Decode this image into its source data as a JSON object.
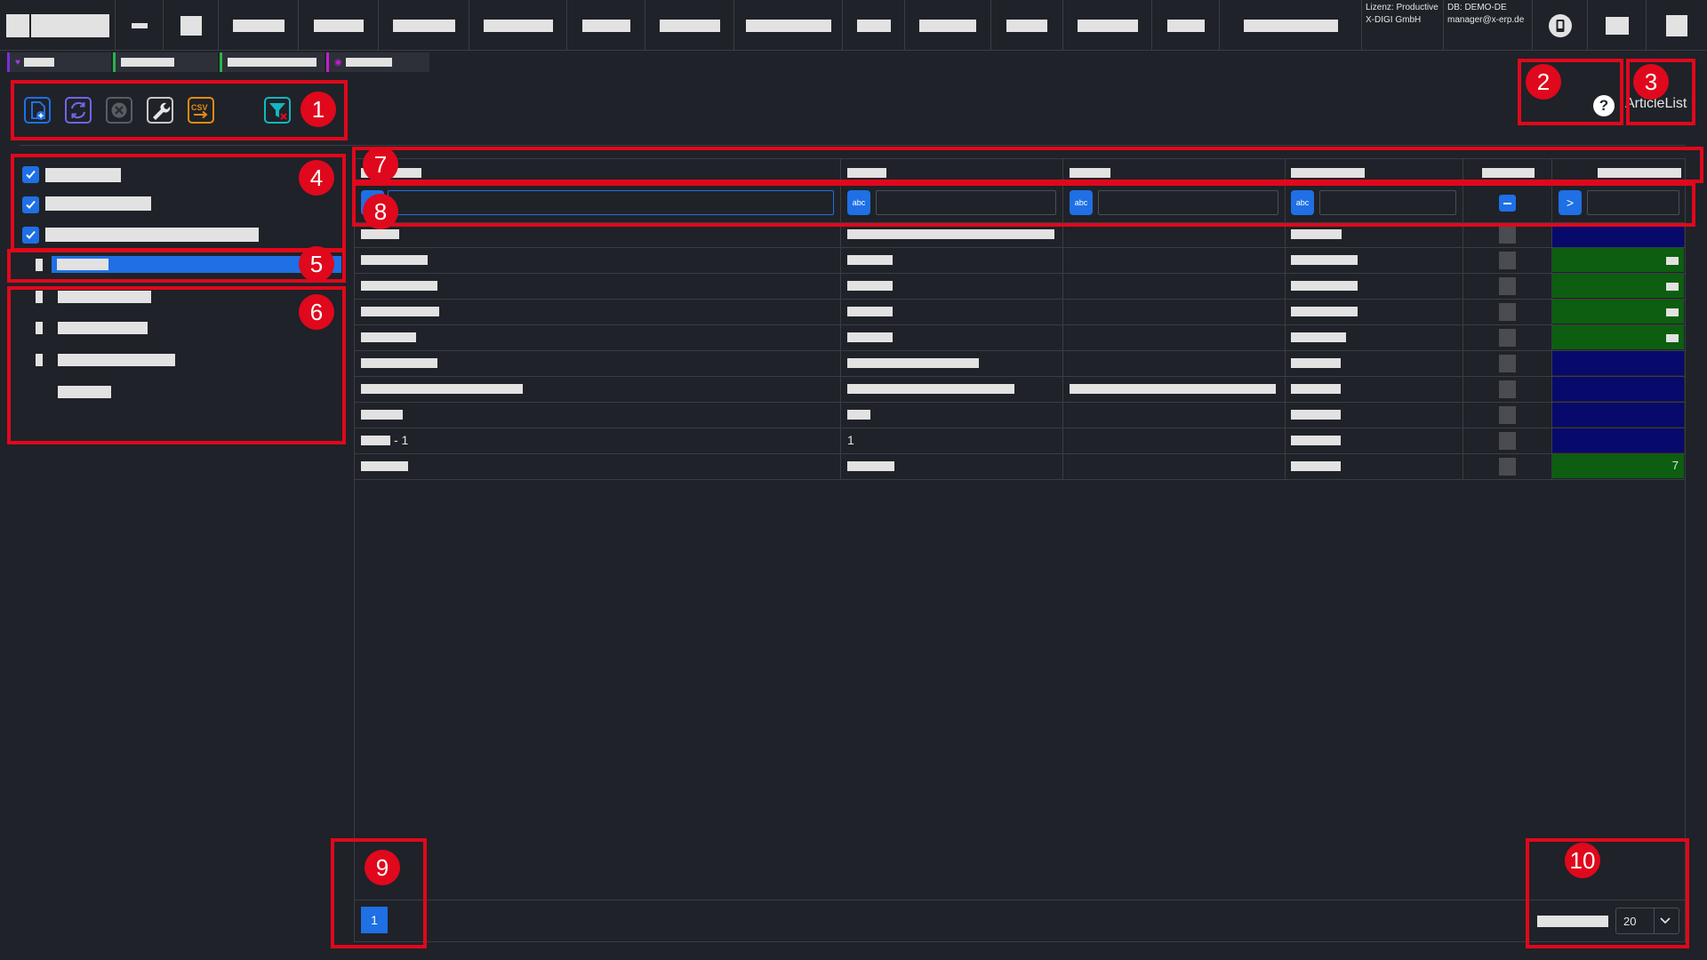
{
  "topbar": {
    "license_line": "Lizenz: Productive",
    "company": "X-DIGI GmbH",
    "db_line": "DB: DEMO-DE",
    "user": "manager@x-erp.de"
  },
  "page": {
    "title": "ArticleList",
    "help_icon": "question-circle-icon"
  },
  "toolbar": {
    "icons": [
      "new-document-icon",
      "refresh-icon",
      "cancel-icon",
      "wrench-icon",
      "csv-export-icon",
      "clear-filter-icon"
    ],
    "csv_label": "CSV"
  },
  "filters": {
    "abc_label": "abc",
    "mode_icons": [
      "minus-icon",
      "greater-than-icon"
    ]
  },
  "grid": {
    "row_10_col1_suffix": "- 1",
    "row_10_col2": "1",
    "row_11_last": "7"
  },
  "pager": {
    "current_page": "1",
    "page_size": "20"
  },
  "annotations": [
    "1",
    "2",
    "3",
    "4",
    "5",
    "6",
    "7",
    "8",
    "9",
    "10"
  ],
  "colors": {
    "background": "#1f2228",
    "accent_blue": "#1f6fe5",
    "annotation_red": "#e0081c",
    "status_blue": "#070a6b",
    "status_green": "#0d5e10"
  }
}
